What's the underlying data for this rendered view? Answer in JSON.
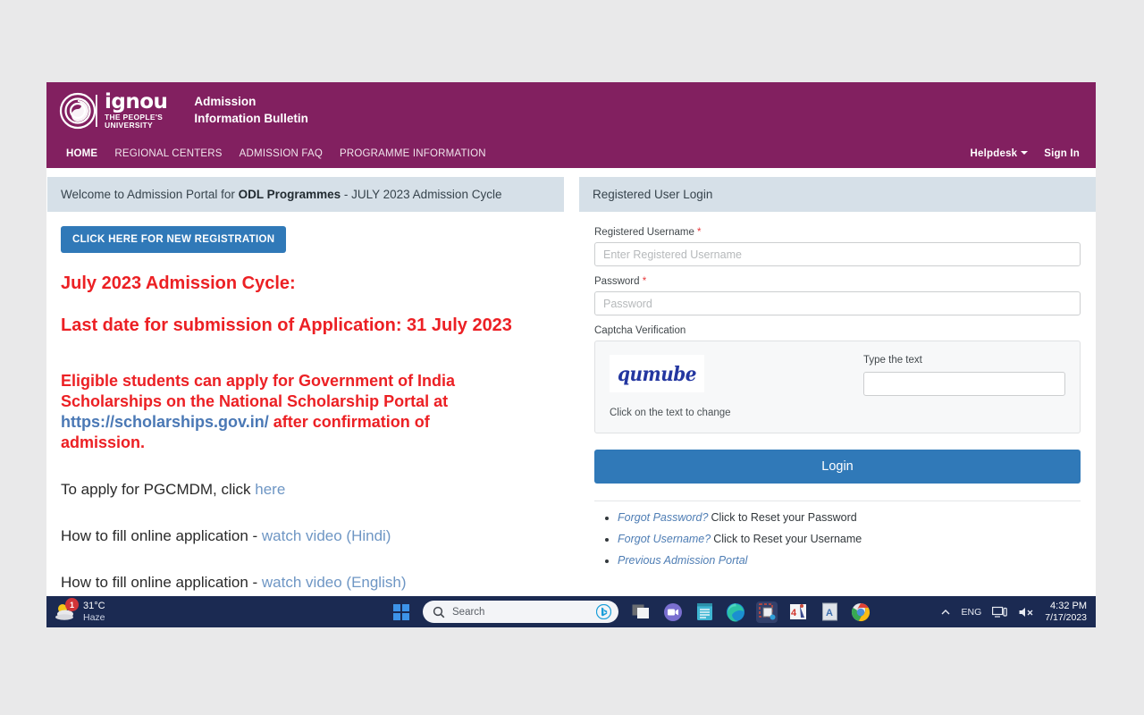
{
  "header": {
    "logo_name": "ignou",
    "logo_tagline_line1": "THE PEOPLE'S",
    "logo_tagline_line2": "UNIVERSITY",
    "title_line1": "Admission",
    "title_line2": "Information Bulletin",
    "brand_color": "#822060"
  },
  "nav": {
    "items": [
      {
        "label": "HOME",
        "active": true
      },
      {
        "label": "REGIONAL CENTERS",
        "active": false
      },
      {
        "label": "ADMISSION FAQ",
        "active": false
      },
      {
        "label": "PROGRAMME INFORMATION",
        "active": false
      }
    ],
    "helpdesk_label": "Helpdesk",
    "signin_label": "Sign In"
  },
  "welcome": {
    "prefix": "Welcome to Admission Portal for ",
    "highlight": "ODL Programmes",
    "suffix": " - JULY 2023 Admission Cycle"
  },
  "left": {
    "register_button": "CLICK HERE FOR NEW REGISTRATION",
    "heading_cycle": "July 2023 Admission Cycle:",
    "heading_lastdate": "Last date for submission of Application: 31 July 2023",
    "scholarship_part1": "Eligible students can apply for Government of India Scholarships on the National Scholarship Portal at ",
    "scholarship_link": "https://scholarships.gov.in/",
    "scholarship_part2": " after confirmation of admission.",
    "pgcmdm_text": "To apply for PGCMDM, click ",
    "pgcmdm_link": "here",
    "howto_hindi_text": "How to fill online application - ",
    "howto_hindi_link": "watch video (Hindi)",
    "howto_english_text": "How to fill online application - ",
    "howto_english_link": "watch video (English)",
    "accent_red": "#ec2024",
    "accent_blue": "#3079b8"
  },
  "login": {
    "panel_title": "Registered User Login",
    "username_label": "Registered Username",
    "username_placeholder": "Enter Registered Username",
    "username_value": "",
    "password_label": "Password",
    "password_placeholder": "Password",
    "password_value": "",
    "captcha_label": "Captcha Verification",
    "captcha_text": "qumube",
    "captcha_hint": "Click on the text to change",
    "captcha_input_label": "Type the text",
    "captcha_input_value": "",
    "login_button": "Login",
    "links": [
      {
        "link": "Forgot Password?",
        "text": "Click to Reset your Password"
      },
      {
        "link": "Forgot Username?",
        "text": "Click to Reset your Username"
      },
      {
        "link": "Previous Admission Portal",
        "text": ""
      }
    ]
  },
  "taskbar": {
    "weather_temp": "31°C",
    "weather_cond": "Haze",
    "weather_badge": "1",
    "search_placeholder": "Search",
    "language": "ENG",
    "clock_time": "4:32 PM",
    "clock_date": "7/17/2023"
  }
}
